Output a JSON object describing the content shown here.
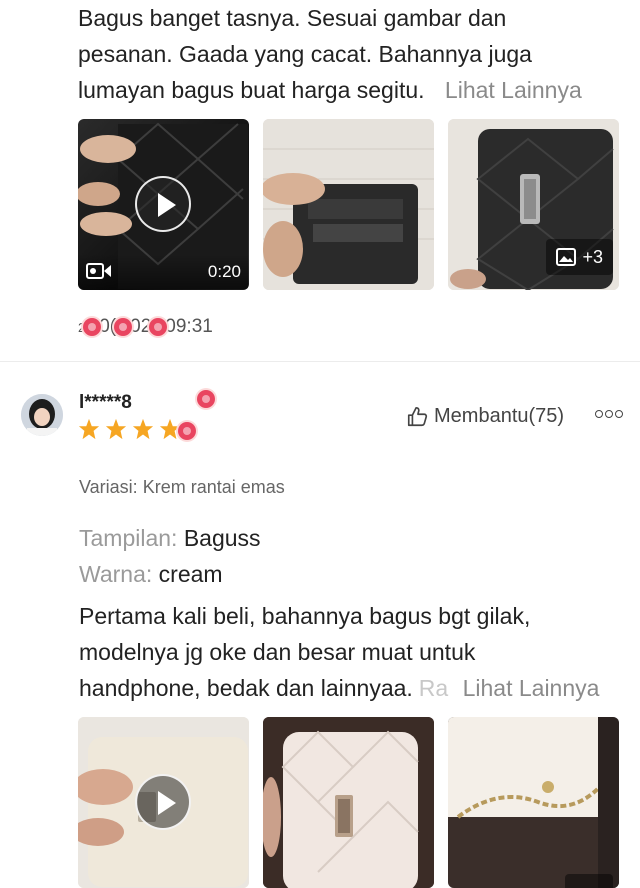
{
  "review1": {
    "text_lines": [
      "Bagus banget tasnya. Sesuai gambar dan",
      "pesanan. Gaada yang cacat. Bahannya juga",
      "lumayan bagus buat harga segitu."
    ],
    "more_label": "Lihat Lainnya",
    "video_duration": "0:20",
    "extra_photos": "+3",
    "date": "2·0(·02·09:31",
    "date_parts": [
      "2",
      "0(",
      "02",
      "09:31"
    ]
  },
  "review2": {
    "username": "l*****8",
    "rating": 4,
    "helpful_label": "Membantu(75)",
    "more_menu": "ooo",
    "variation_label": "Variasi:",
    "variation_value": "Krem rantai emas",
    "attr1_label": "Tampilan:",
    "attr1_value": "Baguss",
    "attr2_label": "Warna:",
    "attr2_value": "cream",
    "text_lines": [
      "Pertama kali beli, bahannya bagus bgt gilak,",
      "modelnya jg oke dan besar muat untuk",
      "handphone, bedak dan lainnyaa."
    ],
    "truncated_tail": "Ra",
    "more_label": "Lihat Lainnya"
  },
  "icons": {
    "play": "play-icon",
    "video": "video-camera-icon",
    "image": "image-icon",
    "thumbs_up": "thumbs-up-icon",
    "star": "star-icon"
  },
  "colors": {
    "star": "#f6a623",
    "heart": "#e94560",
    "muted": "#9a9a9a"
  }
}
